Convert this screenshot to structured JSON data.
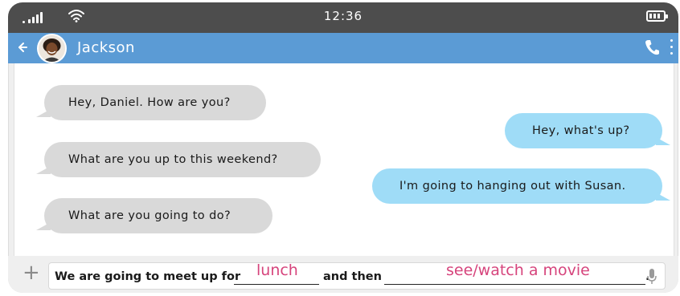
{
  "status_bar": {
    "time": "12:36",
    "icons": [
      "signal-icon",
      "wifi-icon",
      "battery-icon"
    ]
  },
  "header": {
    "contact_name": "Jackson",
    "icons": [
      "back-arrow-icon",
      "avatar",
      "phone-icon",
      "more-vertical-icon"
    ],
    "color": "#5b9bd5"
  },
  "messages": [
    {
      "direction": "incoming",
      "text": "Hey, Daniel. How are you?"
    },
    {
      "direction": "outgoing",
      "text": "Hey, what's up?"
    },
    {
      "direction": "incoming",
      "text": "What are you up to this weekend?"
    },
    {
      "direction": "outgoing",
      "text": "I'm going to hanging out with Susan."
    },
    {
      "direction": "incoming",
      "text": "What are you going to do?"
    }
  ],
  "composer": {
    "plus_icon": "plus-icon",
    "sentence_part1": "We are going to meet up for",
    "answer1": "lunch",
    "sentence_part2": "and then",
    "answer2": "see/watch a movie",
    "sentence_end": ".",
    "mic_icon": "microphone-icon"
  },
  "colors": {
    "incoming_bubble": "#d9d9d9",
    "outgoing_bubble": "#9fdcf7",
    "answer_text": "#d6447c",
    "status_bar": "#4d4d4d"
  }
}
